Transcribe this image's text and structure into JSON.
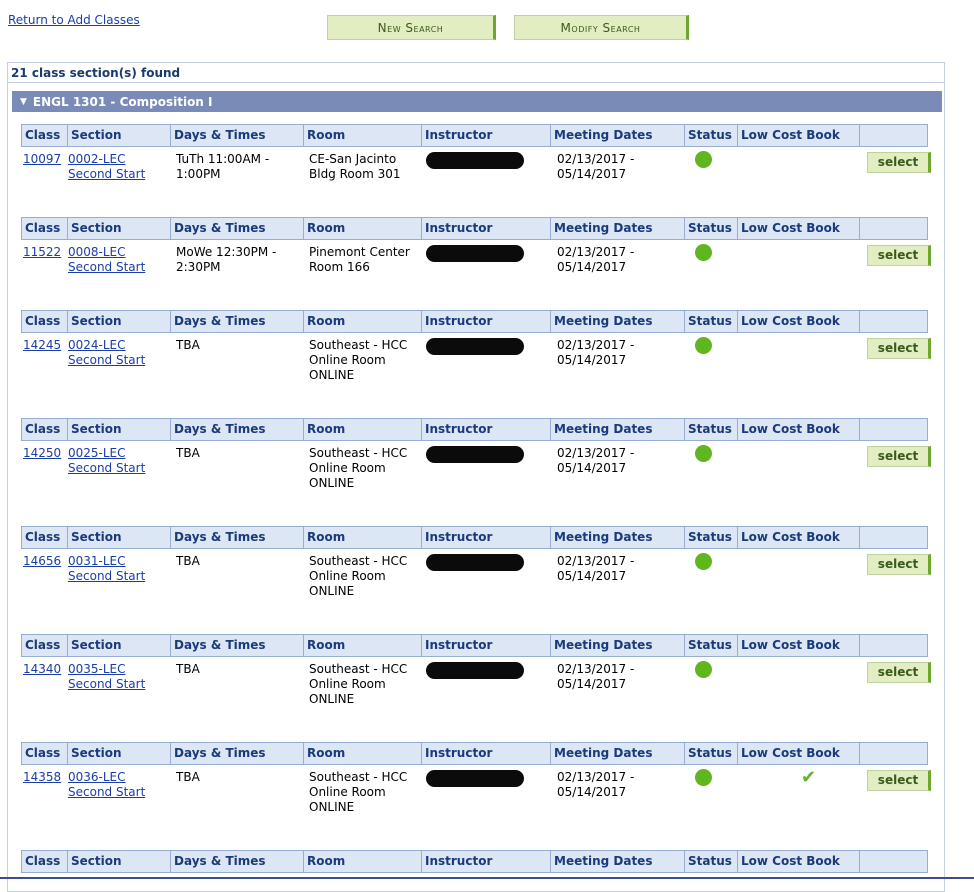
{
  "nav": {
    "return_link": "Return to Add Classes",
    "new_search": "New Search",
    "modify_search": "Modify Search"
  },
  "results": {
    "found_text": "21 class section(s) found",
    "course_title": "ENGL 1301 - Composition I"
  },
  "columns": [
    "Class",
    "Section",
    "Days & Times",
    "Room",
    "Instructor",
    "Meeting Dates",
    "Status",
    "Low Cost Book",
    ""
  ],
  "sections": [
    {
      "class": "10097",
      "section": "0002-LEC",
      "session": "Second Start",
      "days_times": "TuTh 11:00AM -\n1:00PM",
      "room": "CE-San Jacinto\nBldg Room 301",
      "meeting_dates": "02/13/2017 -\n05/14/2017",
      "status": "Open",
      "low_cost_book": false,
      "select_label": "select"
    },
    {
      "class": "11522",
      "section": "0008-LEC",
      "session": "Second Start",
      "days_times": "MoWe 12:30PM -\n2:30PM",
      "room": "Pinemont Center\nRoom 166",
      "meeting_dates": "02/13/2017 -\n05/14/2017",
      "status": "Open",
      "low_cost_book": false,
      "select_label": "select"
    },
    {
      "class": "14245",
      "section": "0024-LEC",
      "session": "Second Start",
      "days_times": "TBA",
      "room": "Southeast - HCC\nOnline Room\nONLINE",
      "meeting_dates": "02/13/2017 -\n05/14/2017",
      "status": "Open",
      "low_cost_book": false,
      "select_label": "select"
    },
    {
      "class": "14250",
      "section": "0025-LEC",
      "session": "Second Start",
      "days_times": "TBA",
      "room": "Southeast - HCC\nOnline Room\nONLINE",
      "meeting_dates": "02/13/2017 -\n05/14/2017",
      "status": "Open",
      "low_cost_book": false,
      "select_label": "select"
    },
    {
      "class": "14656",
      "section": "0031-LEC",
      "session": "Second Start",
      "days_times": "TBA",
      "room": "Southeast - HCC\nOnline Room\nONLINE",
      "meeting_dates": "02/13/2017 -\n05/14/2017",
      "status": "Open",
      "low_cost_book": false,
      "select_label": "select"
    },
    {
      "class": "14340",
      "section": "0035-LEC",
      "session": "Second Start",
      "days_times": "TBA",
      "room": "Southeast - HCC\nOnline Room\nONLINE",
      "meeting_dates": "02/13/2017 -\n05/14/2017",
      "status": "Open",
      "low_cost_book": false,
      "select_label": "select"
    },
    {
      "class": "14358",
      "section": "0036-LEC",
      "session": "Second Start",
      "days_times": "TBA",
      "room": "Southeast - HCC\nOnline Room\nONLINE",
      "meeting_dates": "02/13/2017 -\n05/14/2017",
      "status": "Open",
      "low_cost_book": true,
      "select_label": "select"
    },
    {
      "header_only": true
    }
  ],
  "colors": {
    "accent_green": "#5fb61f",
    "course_bar": "#7b8bb8",
    "header_bg": "#dce6f5",
    "link": "#1b3da8"
  }
}
